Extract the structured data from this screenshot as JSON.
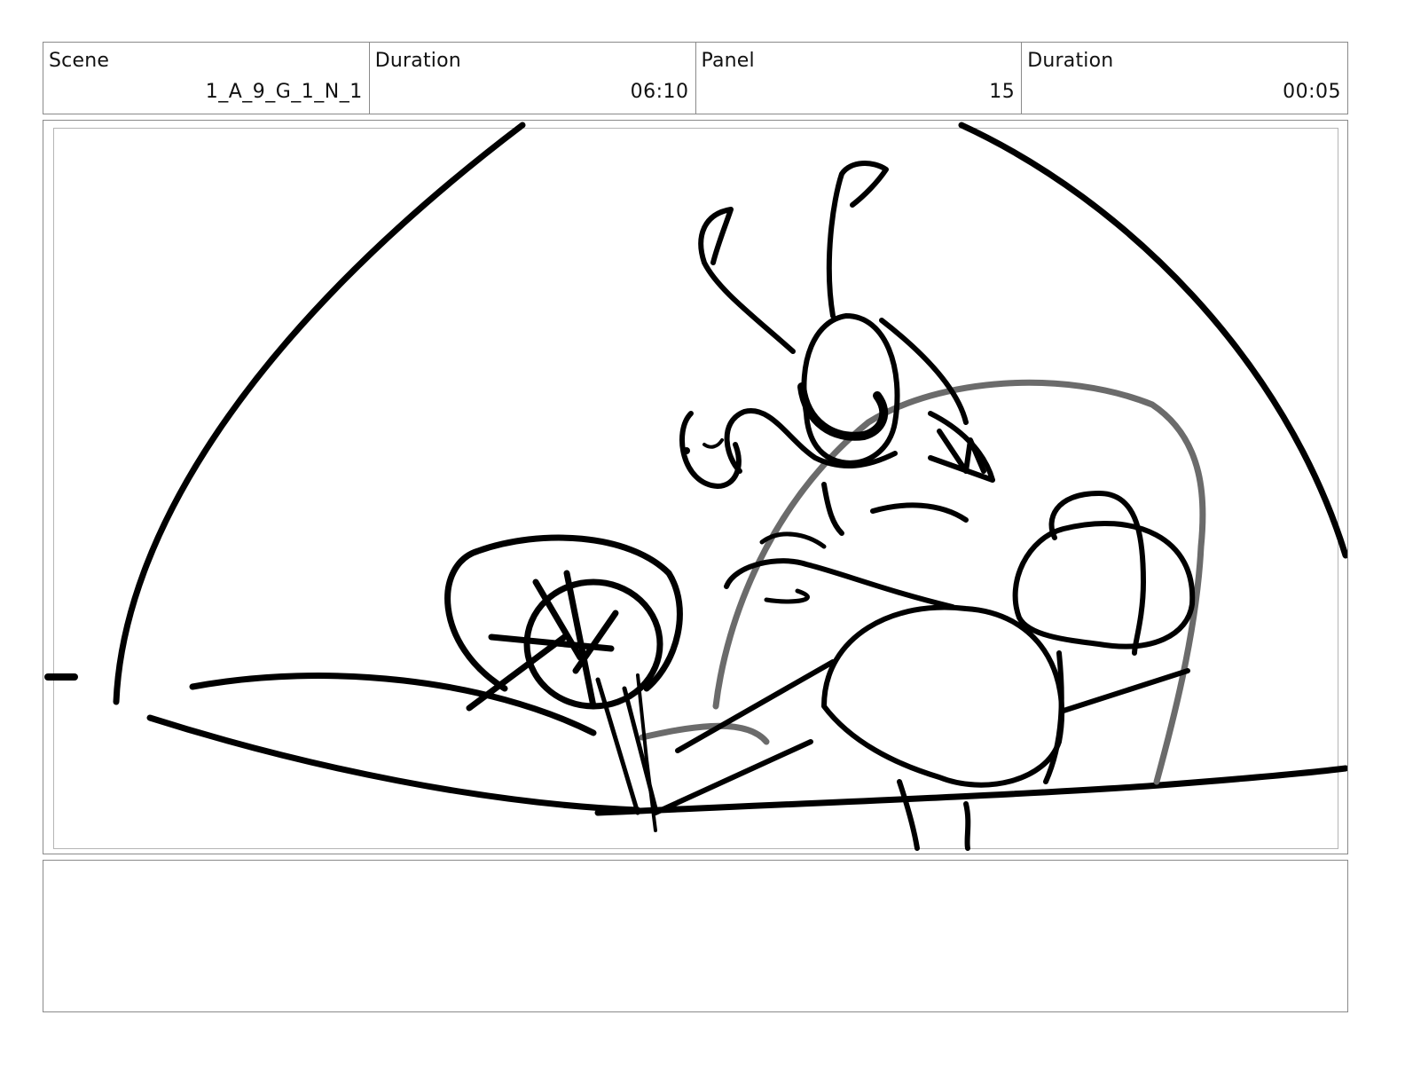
{
  "header": {
    "scene_label": "Scene",
    "scene_value": "1_A_9_G_1_N_1",
    "scene_duration_label": "Duration",
    "scene_duration_value": "06:10",
    "panel_label": "Panel",
    "panel_value": "15",
    "panel_duration_label": "Duration",
    "panel_duration_value": "00:05"
  },
  "panel": {
    "sketch_icon": "storyboard-sketch"
  },
  "notes": {
    "text": ""
  }
}
